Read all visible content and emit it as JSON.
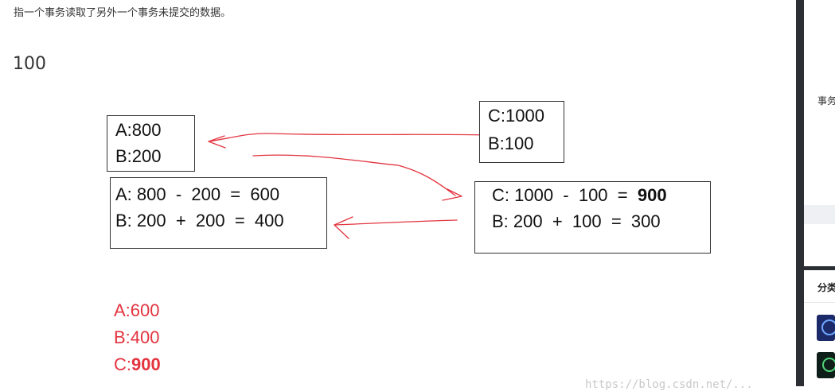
{
  "article": {
    "intro_text": "指一个事务读取了另外一个事务未提交的数据。",
    "number_100": "100"
  },
  "figure": {
    "box1": {
      "line1": "A:800",
      "line2": "B:200"
    },
    "box2": {
      "line1": "C:1000",
      "line2": "B:100"
    },
    "box3": {
      "line1": "A: 800  -  200  =  600",
      "line2": "B: 200  +  200  =  400"
    },
    "box4": {
      "line1_prefix": "C: 1000  -  100  =  ",
      "line1_result": "900",
      "line2": "B: 200  +  100  =  300"
    },
    "result": {
      "a": "A:600",
      "b": "B:400",
      "c_prefix": "C:",
      "c_value": "900"
    },
    "arrow_color": "#e3343f"
  },
  "watermark": "https://blog.csdn.net/...",
  "sidebar": {
    "card_text": "事务",
    "section_title": "分类",
    "thumb1_icon": "thumbnail-blue",
    "thumb2_icon": "thumbnail-green"
  }
}
